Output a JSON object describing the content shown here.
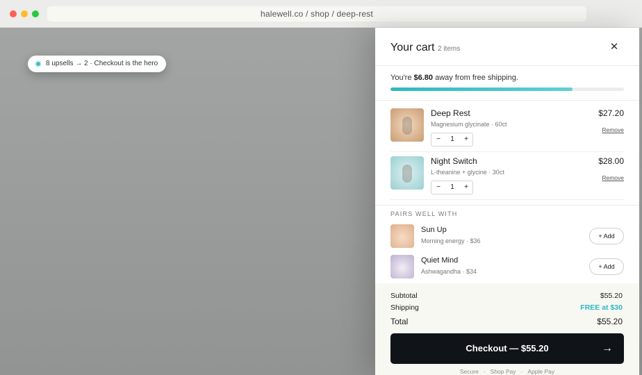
{
  "browser": {
    "url": "halewell.co / shop / deep-rest"
  },
  "annotation": {
    "text": "8 upsells → 2 · Checkout is the hero"
  },
  "cart": {
    "title": "Your cart",
    "count": "2 items",
    "close_icon": "close-icon"
  },
  "shipping": {
    "prefix": "You're ",
    "amount": "$6.80",
    "suffix": " away from free shipping.",
    "progress_fraction": 0.78,
    "bar_color": "#2fb7c0"
  },
  "items": [
    {
      "name": "Deep Rest",
      "subtitle": "Magnesium glycinate · 60ct",
      "price": "$27.20",
      "remove_label": "Remove",
      "qty": "1",
      "minus": "−",
      "plus": "+"
    },
    {
      "name": "Night Switch",
      "subtitle": "L-theanine + glycine · 30ct",
      "price": "$28.00",
      "remove_label": "Remove",
      "qty": "1",
      "minus": "−",
      "plus": "+"
    }
  ],
  "pairs": {
    "title": "PAIRS WELL WITH",
    "items": [
      {
        "name": "Sun Up",
        "subtitle": "Morning energy · $36",
        "button": "+ Add"
      },
      {
        "name": "Quiet Mind",
        "subtitle": "Ashwagandha · $34",
        "button": "+ Add"
      }
    ]
  },
  "totals": {
    "subtotal_label": "Subtotal",
    "subtotal_value": "$55.20",
    "shipping_label": "Shipping",
    "shipping_value": "FREE at $30",
    "total_label": "Total",
    "total_value": "$55.20"
  },
  "checkout": {
    "label": "Checkout — $55.20",
    "arrow": "→"
  },
  "payment": {
    "methods": [
      "Secure",
      "Shop Pay",
      "Apple Pay"
    ],
    "separator": "·"
  },
  "colors": {
    "accent": "#2fb7c0",
    "checkout_bg": "#101418"
  }
}
